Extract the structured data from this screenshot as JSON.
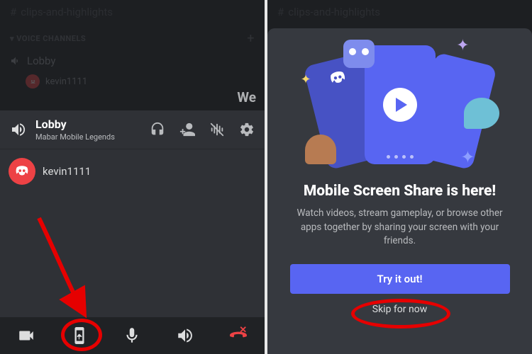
{
  "colors": {
    "accent": "#5865f2",
    "danger": "#ed4245",
    "annotation": "#e60000"
  },
  "bg": {
    "text_channel": "clips-and-highlights",
    "voice_heading": "VOICE CHANNELS",
    "voice_channel": "Lobby",
    "voice_user": "kevin1111",
    "partial_text": "We"
  },
  "voice_panel": {
    "title": "Lobby",
    "subtitle": "Mabar Mobile Legends",
    "member": "kevin1111"
  },
  "sheet": {
    "title": "Mobile Screen Share is here!",
    "description": "Watch videos, stream gameplay, or browse other apps together by sharing your screen with your friends.",
    "primary": "Try it out!",
    "skip": "Skip for now"
  }
}
